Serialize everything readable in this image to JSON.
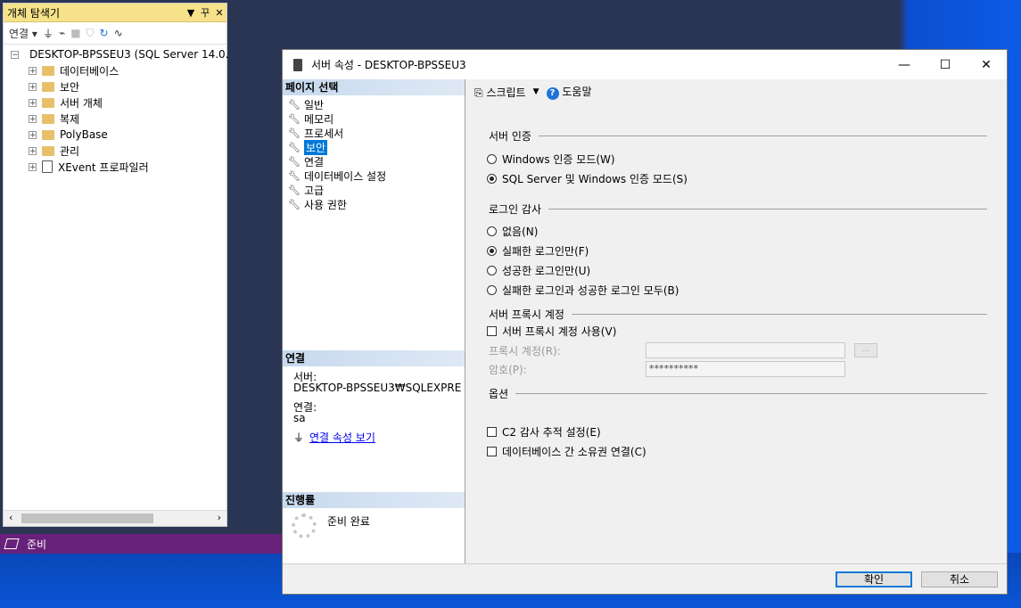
{
  "object_explorer": {
    "title": "개체 탐색기",
    "title_buttons": [
      "▼",
      "꾸",
      "✕"
    ],
    "toolbar": {
      "connect_label": "연결"
    },
    "server_node": "DESKTOP-BPSSEU3 (SQL Server 14.0.",
    "tree_items": [
      {
        "label": "데이터베이스"
      },
      {
        "label": "보안"
      },
      {
        "label": "서버 개체"
      },
      {
        "label": "복제"
      },
      {
        "label": "PolyBase"
      },
      {
        "label": "관리"
      },
      {
        "label": "XEvent 프로파일러"
      }
    ]
  },
  "status_bar": {
    "text": "준비"
  },
  "dialog": {
    "title": "서버 속성 - DESKTOP-BPSSEU3",
    "window_buttons": [
      "—",
      "☐",
      "✕"
    ],
    "page_select_header": "페이지 선택",
    "pages": [
      "일반",
      "메모리",
      "프로세서",
      "보안",
      "연결",
      "데이터베이스 설정",
      "고급",
      "사용 권한"
    ],
    "selected_page": "보안",
    "connection": {
      "header": "연결",
      "server_label": "서버:",
      "server_value": "DESKTOP-BPSSEU3₩SQLEXPRE",
      "conn_label": "연결:",
      "conn_value": "sa",
      "link_label": "연결 속성 보기"
    },
    "progress": {
      "header": "진행률",
      "status": "준비 완료"
    },
    "toolbar": {
      "script_label": "스크립트",
      "help_label": "도움말"
    },
    "server_auth": {
      "header": "서버 인증",
      "options": [
        "Windows 인증 모드(W)",
        "SQL Server 및 Windows 인증 모드(S)"
      ],
      "selected_index": 1
    },
    "login_audit": {
      "header": "로그인 감사",
      "options": [
        "없음(N)",
        "실패한 로그인만(F)",
        "성공한 로그인만(U)",
        "실패한 로그인과 성공한 로그인 모두(B)"
      ],
      "selected_index": 1
    },
    "proxy": {
      "header": "서버 프록시 계정",
      "enable_label": "서버 프록시 계정 사용(V)",
      "enabled": false,
      "account_label": "프록시 계정(R):",
      "account_value": "",
      "password_label": "암호(P):",
      "password_value": "**********",
      "browse_label": "..."
    },
    "options": {
      "header": "옵션",
      "c2_label": "C2 감사 추적 설정(E)",
      "c2_checked": false,
      "chaining_label": "데이터베이스 간 소유권 연결(C)",
      "chaining_checked": false
    },
    "buttons": {
      "ok": "확인",
      "cancel": "취소"
    }
  }
}
